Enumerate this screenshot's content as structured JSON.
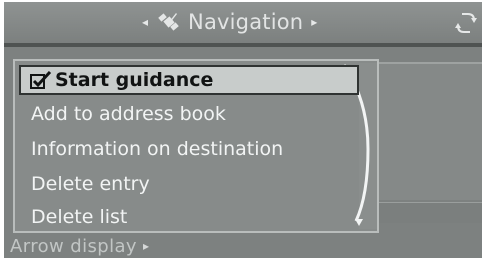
{
  "header": {
    "title": "Navigation",
    "left_arrow": "◂",
    "right_arrow": "▸",
    "satellite_icon": "satellite-icon",
    "cycle_icon": "cycle-arrows-icon"
  },
  "menu": {
    "selected_icon": "check-icon",
    "items": [
      {
        "label": "Start guidance",
        "selected": true
      },
      {
        "label": "Add to address book"
      },
      {
        "label": "Information on destination"
      },
      {
        "label": "Delete entry"
      },
      {
        "label": "Delete list"
      }
    ]
  },
  "footer": {
    "label": "Arrow display",
    "arrow": "▸"
  },
  "colors": {
    "background": "#7d8180",
    "highlight": "#c8cccb",
    "menu_text": "#f2f4f4"
  }
}
